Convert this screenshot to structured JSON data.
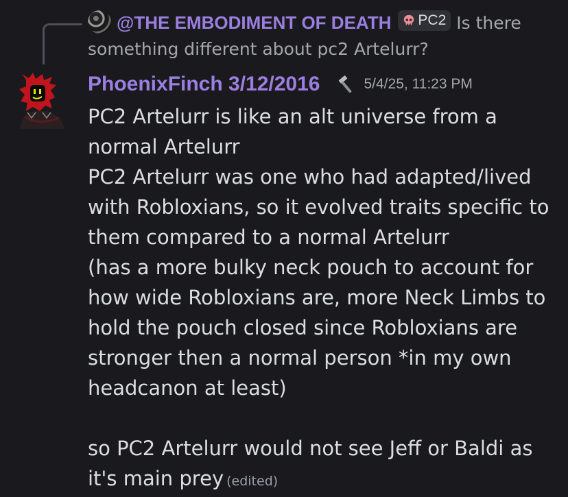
{
  "reply": {
    "author": "@THE EMBODIMENT OF DEATH",
    "tag": "PC2",
    "tag_icon": "skull-icon",
    "text": "Is there something different about pc2 Artelurr?"
  },
  "message": {
    "author": "PhoenixFinch  3/12/2016",
    "badge_icon": "hammer-icon",
    "timestamp": "5/4/25, 11:23 PM",
    "lines": [
      "PC2 Artelurr is like an alt universe from a normal Artelurr",
      "PC2 Artelurr was one who had adapted/lived with Robloxians, so it evolved traits specific to them compared to a normal Artelurr",
      "(has a more bulky neck pouch to account for how wide Robloxians are, more Neck Limbs to hold the pouch closed since Robloxians are stronger then a normal person *in my own headcanon at least)",
      "so PC2 Artelurr would not see Jeff or Baldi as it's main prey"
    ],
    "edited_label": "(edited)"
  },
  "colors": {
    "background": "#1a1a1e",
    "username": "#9b7fe0",
    "text": "#dbdee1",
    "muted": "#a5a7ae"
  }
}
